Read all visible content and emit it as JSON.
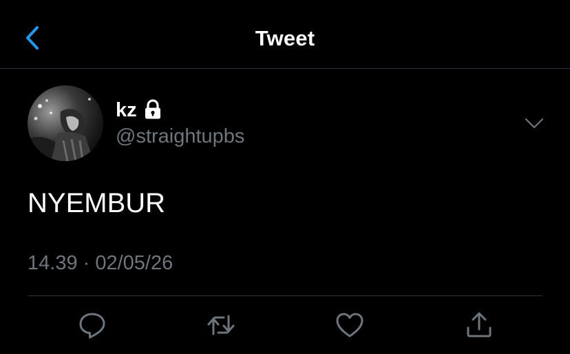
{
  "header": {
    "title": "Tweet"
  },
  "icons": {
    "back": "chevron-left-icon",
    "lock": "lock-icon",
    "caret": "chevron-down-icon",
    "reply": "reply-icon",
    "retweet": "retweet-icon",
    "like": "heart-icon",
    "share": "share-icon"
  },
  "tweet": {
    "author": {
      "display_name": "kz",
      "handle": "@straightupbs",
      "protected": true
    },
    "text": "NYEMBUR",
    "timestamp": "14.39 · 02/05/26"
  },
  "colors": {
    "background": "#000000",
    "accent": "#1d9bf0",
    "primary_text": "#ffffff",
    "secondary_text": "#6e767d",
    "divider": "#2f3336"
  }
}
